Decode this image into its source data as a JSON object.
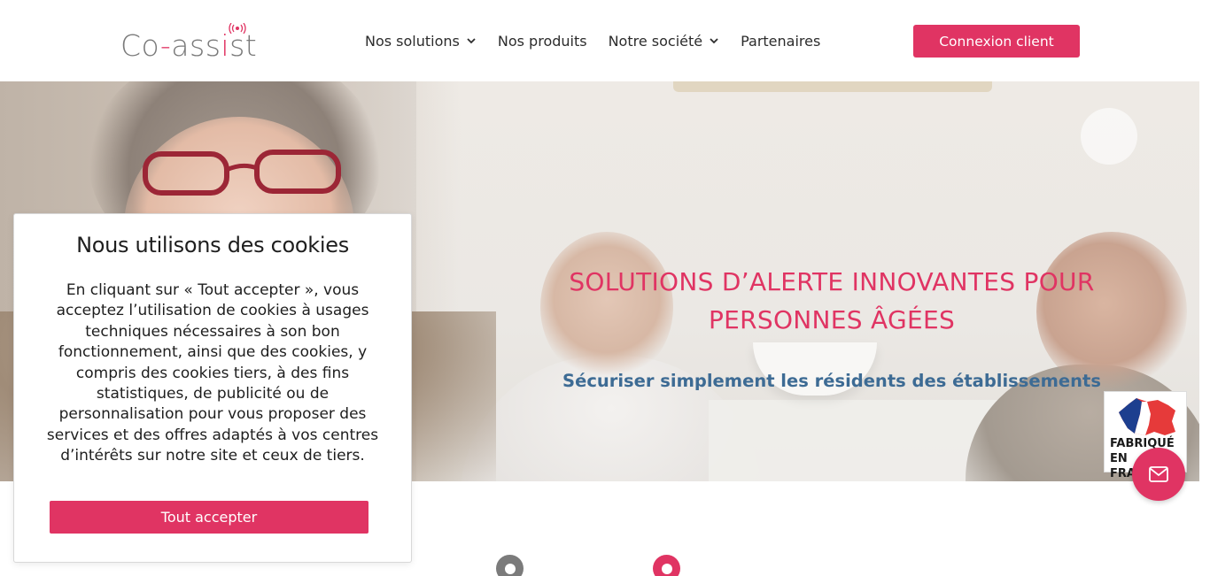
{
  "brand": {
    "logo_text_a": "Co",
    "logo_text_dash": "-",
    "logo_text_b": "ass",
    "logo_text_i": "i",
    "logo_text_c": "st",
    "accent_color": "#e03463",
    "secondary_color": "#3d6b94"
  },
  "nav": {
    "items": [
      {
        "label": "Nos solutions",
        "has_dropdown": true
      },
      {
        "label": "Nos produits",
        "has_dropdown": false
      },
      {
        "label": "Notre société",
        "has_dropdown": true
      },
      {
        "label": "Partenaires",
        "has_dropdown": false
      }
    ],
    "login_label": "Connexion client"
  },
  "hero": {
    "title": "SOLUTIONS D’ALERTE INNOVANTES POUR PERSONNES ÂGÉES",
    "subtitle": "Sécuriser simplement les résidents des établissements"
  },
  "badge": {
    "line1": "FABRIQUÉ EN",
    "line2": "FRANCE"
  },
  "fab": {
    "icon": "mail-icon"
  },
  "cookie": {
    "title": "Nous utilisons des cookies",
    "text": "En cliquant sur « Tout accepter », vous acceptez l’utilisation de cookies à usages techniques nécessaires à son bon fonctionnement, ainsi que des cookies, y compris des cookies tiers, à des fins statistiques, de publicité ou de personnalisation pour vous proposer des services et des offres adaptés à vos centres d’intérêts sur notre site et ceux de tiers.",
    "accept_label": "Tout accepter"
  }
}
